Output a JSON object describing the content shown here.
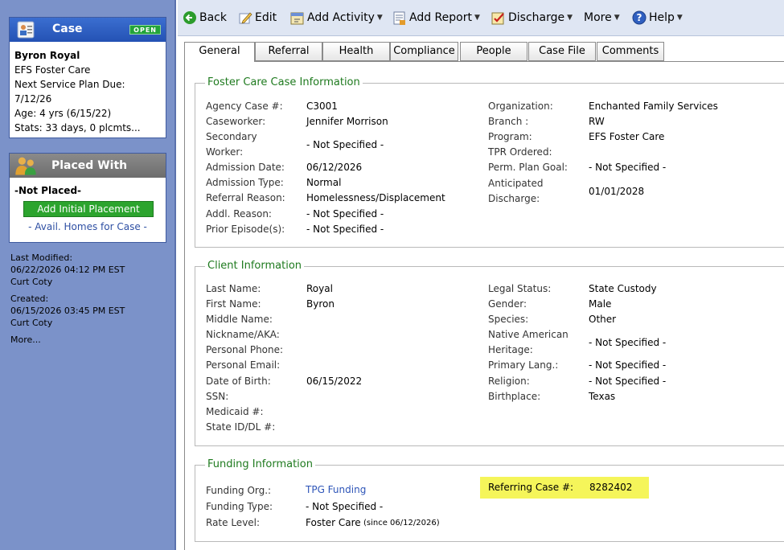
{
  "sidebar": {
    "case_panel": {
      "title": "Case",
      "badge": "OPEN",
      "client_name": "Byron Royal",
      "program": "EFS Foster Care",
      "service_plan_label": "Next Service Plan Due:",
      "service_plan_date": "7/12/26",
      "age": "Age: 4 yrs (6/15/22)",
      "stats": "Stats: 33 days, 0 plcmts..."
    },
    "placed_panel": {
      "title": "Placed With",
      "status": "-Not Placed-",
      "add_button": "Add Initial Placement",
      "avail_link": "- Avail. Homes for Case -"
    },
    "last_modified_label": "Last Modified:",
    "last_modified_date": "06/22/2026 04:12 PM EST",
    "last_modified_by": "Curt Coty",
    "created_label": "Created:",
    "created_date": "06/15/2026 03:45 PM EST",
    "created_by": "Curt Coty",
    "more": "More..."
  },
  "toolbar": {
    "back": "Back",
    "edit": "Edit",
    "add_activity": "Add Activity",
    "add_report": "Add Report",
    "discharge": "Discharge",
    "more": "More",
    "help": "Help"
  },
  "tabs": [
    "General",
    "Referral",
    "Health",
    "Compliance",
    "People",
    "Case File",
    "Comments"
  ],
  "foster_care": {
    "legend": "Foster Care Case Information",
    "agency_case_label": "Agency Case #:",
    "agency_case": "C3001",
    "caseworker_label": "Caseworker:",
    "caseworker": "Jennifer Morrison",
    "secondary_label_1": "Secondary",
    "secondary_label_2": "Worker:",
    "secondary": "- Not Specified -",
    "admission_date_label": "Admission Date:",
    "admission_date": "06/12/2026",
    "admission_type_label": "Admission Type:",
    "admission_type": "Normal",
    "referral_reason_label": "Referral Reason:",
    "referral_reason": "Homelessness/Displacement",
    "addl_reason_label": "Addl. Reason:",
    "addl_reason": "- Not Specified -",
    "prior_episodes_label": "Prior Episode(s):",
    "prior_episodes": "- Not Specified -",
    "organization_label": "Organization:",
    "organization": "Enchanted Family Services",
    "branch_label": "Branch :",
    "branch": "RW",
    "program_label": "Program:",
    "program": "EFS Foster Care",
    "tpr_label": "TPR Ordered:",
    "perm_plan_label": "Perm. Plan Goal:",
    "perm_plan": "- Not Specified -",
    "anticipated_label_1": "Anticipated",
    "anticipated_label_2": "Discharge:",
    "anticipated": "01/01/2028"
  },
  "client": {
    "legend": "Client Information",
    "last_name_label": "Last Name:",
    "last_name": "Royal",
    "first_name_label": "First Name:",
    "first_name": "Byron",
    "middle_name_label": "Middle Name:",
    "nickname_label": "Nickname/AKA:",
    "phone_label": "Personal Phone:",
    "email_label": "Personal Email:",
    "dob_label": "Date of Birth:",
    "dob": "06/15/2022",
    "ssn_label": "SSN:",
    "medicaid_label": "Medicaid #:",
    "state_id_label": "State ID/DL #:",
    "legal_status_label": "Legal Status:",
    "legal_status": "State Custody",
    "gender_label": "Gender:",
    "gender": "Male",
    "species_label": "Species:",
    "species": "Other",
    "native_label_1": "Native American",
    "native_label_2": "Heritage:",
    "native": "- Not Specified -",
    "primary_lang_label": "Primary Lang.:",
    "primary_lang": "- Not Specified -",
    "religion_label": "Religion:",
    "religion": "- Not Specified -",
    "birthplace_label": "Birthplace:",
    "birthplace": "Texas"
  },
  "funding": {
    "legend": "Funding Information",
    "org_label": "Funding Org.:",
    "org": "TPG Funding",
    "type_label": "Funding Type:",
    "type": "- Not Specified -",
    "rate_label": "Rate Level:",
    "rate": "Foster Care",
    "rate_since": "(since 06/12/2026)",
    "referring_label": "Referring Case #:",
    "referring": "8282402"
  },
  "colors": {
    "sidebar_bg": "#7b92c9",
    "legend_green": "#1e7a1e",
    "highlight": "#f5f55a",
    "badge_green": "#22a33a"
  }
}
